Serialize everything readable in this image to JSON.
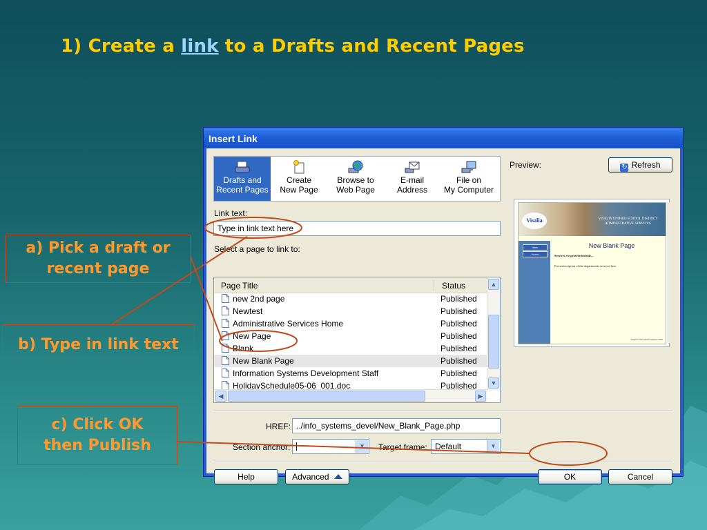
{
  "slide": {
    "title_prefix": "1) Create a ",
    "title_link": "link",
    "title_suffix": " to a Drafts and Recent Pages",
    "callout_a": "a) Pick a draft or recent page",
    "callout_b": "b) Type in link text",
    "callout_c": "c) Click OK then Publish",
    "colors": {
      "title": "#ffcc00",
      "callout_text": "#ff9a2e",
      "callout_border": "#c24a1a"
    }
  },
  "dialog": {
    "title": "Insert Link",
    "toolbar": [
      {
        "label": "Drafts and\nRecent Pages",
        "icon": "drafts-icon",
        "active": true
      },
      {
        "label": "Create\nNew Page",
        "icon": "new-page-icon",
        "active": false
      },
      {
        "label": "Browse to\nWeb Page",
        "icon": "globe-icon",
        "active": false
      },
      {
        "label": "E-mail\nAddress",
        "icon": "email-icon",
        "active": false
      },
      {
        "label": "File on\nMy Computer",
        "icon": "computer-icon",
        "active": false
      }
    ],
    "preview_label": "Preview:",
    "refresh_label": "Refresh",
    "link_text_label": "Link text:",
    "link_text_value": "Type in link text here",
    "select_label": "Select a page to link to:",
    "columns": {
      "title": "Page Title",
      "status": "Status"
    },
    "pages": [
      {
        "title": "new 2nd page",
        "status": "Published"
      },
      {
        "title": "Newtest",
        "status": "Published"
      },
      {
        "title": "Administrative Services Home",
        "status": "Published"
      },
      {
        "title": "New Page",
        "status": "Published"
      },
      {
        "title": "Blank",
        "status": "Published"
      },
      {
        "title": "New Blank Page",
        "status": "Published",
        "selected": true
      },
      {
        "title": "Information Systems Development Staff",
        "status": "Published"
      },
      {
        "title": "HolidaySchedule05-06_001.doc",
        "status": "Published"
      }
    ],
    "href_label": "HREF:",
    "href_value": "../info_systems_devel/New_Blank_Page.php",
    "anchor_label": "Section anchor:",
    "anchor_value": "",
    "target_label": "Target frame:",
    "target_value": "Default",
    "buttons": {
      "help": "Help",
      "advanced": "Advanced",
      "ok": "OK",
      "cancel": "Cancel"
    },
    "preview": {
      "logo": "Visalia",
      "district": "VISALIA UNIFIED SCHOOL DISTRICT ADMINISTRATIVE SERVICES",
      "nav": [
        "Item",
        "Home"
      ],
      "heading": "New Blank Page",
      "line1": "Services we provide include...",
      "line2": "Put a description of the departments services here",
      "footer": "Visalia Unified School District 2005"
    }
  }
}
